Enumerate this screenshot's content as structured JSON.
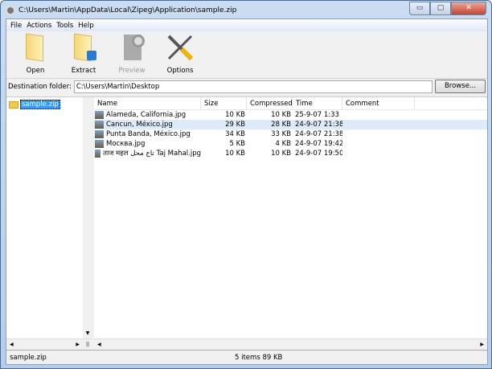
{
  "window": {
    "title": "C:\\Users\\Martin\\AppData\\Local\\Zipeg\\Application\\sample.zip",
    "minimize": "▭",
    "maximize": "▢",
    "close": "✕"
  },
  "menu": [
    "File",
    "Actions",
    "Tools",
    "Help"
  ],
  "toolbar": [
    {
      "label": "Open",
      "icon": "folder-icon",
      "enabled": true
    },
    {
      "label": "Extract",
      "icon": "extract-folder-icon",
      "enabled": true
    },
    {
      "label": "Preview",
      "icon": "preview-icon",
      "enabled": false
    },
    {
      "label": "Options",
      "icon": "tools-icon",
      "enabled": true
    }
  ],
  "destination": {
    "label": "Destination folder:",
    "value": "C:\\Users\\Martin\\Desktop",
    "browse": "Browse..."
  },
  "tree": {
    "items": [
      {
        "label": "sample.zip",
        "selected": true
      }
    ]
  },
  "list": {
    "columns": [
      "Name",
      "Size",
      "Compressed",
      "Time",
      "Comment"
    ],
    "rows": [
      {
        "name": "Alameda, California.jpg",
        "size": "10 KB",
        "compressed": "10 KB",
        "time": "25-9-07 1:33",
        "comment": ""
      },
      {
        "name": "Cancun, México.jpg",
        "size": "29 KB",
        "compressed": "28 KB",
        "time": "24-9-07 21:38",
        "comment": "",
        "selected": true
      },
      {
        "name": "Punta Banda, México.jpg",
        "size": "34 KB",
        "compressed": "33 KB",
        "time": "24-9-07 21:38",
        "comment": ""
      },
      {
        "name": "Москва.jpg",
        "size": "5 KB",
        "compressed": "4 KB",
        "time": "24-9-07 19:42",
        "comment": ""
      },
      {
        "name": "ताज महल تاج محل Taj Mahal.jpg",
        "size": "10 KB",
        "compressed": "10 KB",
        "time": "24-9-07 19:50",
        "comment": ""
      }
    ]
  },
  "status": {
    "left": "sample.zip",
    "center": "5 items  89 KB"
  },
  "colors": {
    "selection": "#3399ff",
    "row_highlight": "#dceaf9"
  }
}
